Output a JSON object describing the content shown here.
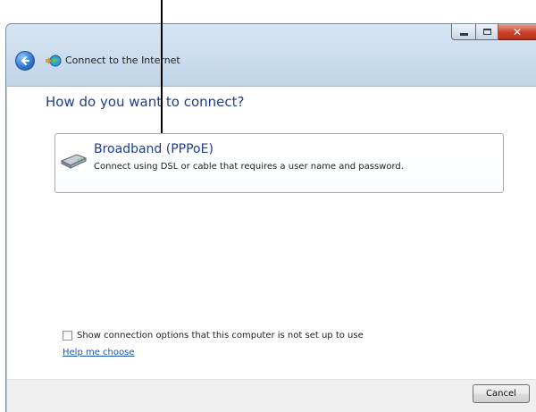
{
  "window": {
    "title": "Connect to the Internet",
    "caption_buttons": [
      "minimize",
      "maximize",
      "close"
    ],
    "close_glyph": "✕"
  },
  "heading": "How do you want to connect?",
  "options": [
    {
      "icon": "modem-icon",
      "title": "Broadband (PPPoE)",
      "description": "Connect using DSL or cable that requires a user name and password."
    }
  ],
  "show_options_checkbox": {
    "label": "Show connection options that this computer is not set up to use",
    "checked": false
  },
  "help_link": "Help me choose",
  "footer": {
    "cancel_label": "Cancel"
  },
  "colors": {
    "heading": "#1e3d8f",
    "link": "#1a58b0",
    "card_border": "#7fb3e4"
  }
}
